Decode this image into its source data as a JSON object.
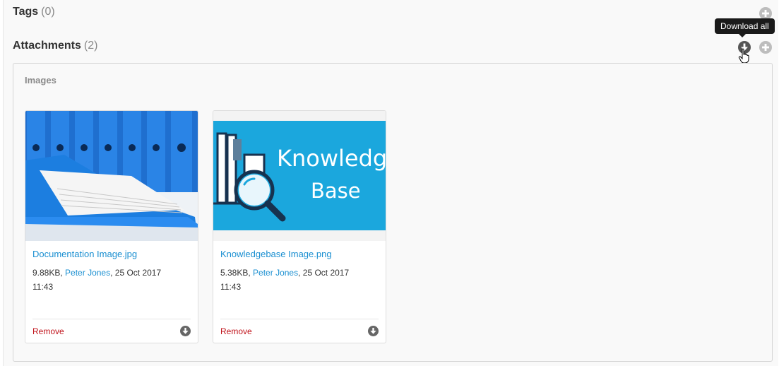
{
  "tags": {
    "title": "Tags",
    "count": "(0)"
  },
  "attachments": {
    "title": "Attachments",
    "count": "(2)",
    "tooltip": "Download all",
    "group_label": "Images",
    "files": [
      {
        "name": "Documentation Image.jpg",
        "size": "9.88KB",
        "author": "Peter Jones",
        "date": "25 Oct 2017",
        "time": "11:43",
        "remove_label": "Remove",
        "thumbnail": "blue-binders-photo"
      },
      {
        "name": "Knowledgebase Image.png",
        "size": "5.38KB",
        "author": "Peter Jones",
        "date": "25 Oct 2017",
        "time": "11:43",
        "remove_label": "Remove",
        "thumbnail_line1": "Knowledge",
        "thumbnail_line2": "Base"
      }
    ]
  },
  "icons": {
    "add": "plus-circle-icon",
    "download": "download-circle-icon",
    "cursor": "hand-pointer-icon"
  },
  "colors": {
    "link": "#1a8fd1",
    "remove": "#c0121a",
    "icon_gray": "#bdbdbd",
    "icon_dark": "#555555",
    "kb_background": "#1ba7dd"
  }
}
